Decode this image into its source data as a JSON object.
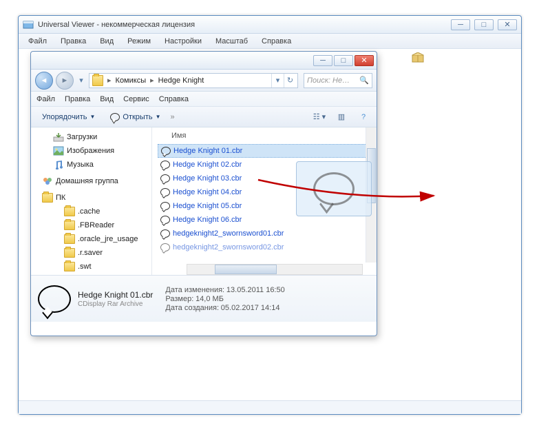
{
  "outer": {
    "title": "Universal Viewer - некоммерческая лицензия",
    "menu": [
      "Файл",
      "Правка",
      "Вид",
      "Режим",
      "Настройки",
      "Масштаб",
      "Справка"
    ]
  },
  "explorer": {
    "breadcrumb": {
      "items": [
        "Комиксы",
        "Hedge Knight"
      ]
    },
    "search_placeholder": "Поиск: He…",
    "menu": [
      "Файл",
      "Правка",
      "Вид",
      "Сервис",
      "Справка"
    ],
    "toolbar": {
      "organize": "Упорядочить",
      "open": "Открыть"
    },
    "tree": {
      "items": [
        {
          "label": "Загрузки",
          "type": "dl"
        },
        {
          "label": "Изображения",
          "type": "img"
        },
        {
          "label": "Музыка",
          "type": "music"
        }
      ],
      "homegroup": "Домашняя группа",
      "pc": "ПК",
      "pc_items": [
        ".cache",
        ".FBReader",
        ".oracle_jre_usage",
        ".r.saver",
        ".swt"
      ]
    },
    "column_header": "Имя",
    "files": [
      "Hedge Knight 01.cbr",
      "Hedge Knight 02.cbr",
      "Hedge Knight 03.cbr",
      "Hedge Knight 04.cbr",
      "Hedge Knight 05.cbr",
      "Hedge Knight 06.cbr",
      "hedgeknight2_swornsword01.cbr",
      "hedgeknight2_swornsword02.cbr"
    ],
    "details": {
      "name": "Hedge Knight 01.cbr",
      "type": "CDisplay Rar Archive",
      "modified_label": "Дата изменения:",
      "modified": "13.05.2011 16:50",
      "size_label": "Размер:",
      "size": "14,0 МБ",
      "created_label": "Дата создания:",
      "created": "05.02.2017 14:14"
    }
  }
}
